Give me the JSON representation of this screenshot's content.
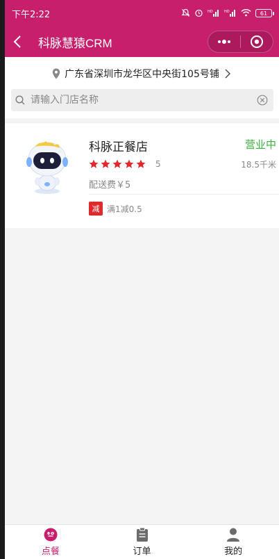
{
  "status_bar": {
    "time": "下午2:22",
    "signal1": "HD",
    "signal2": "HD",
    "battery": "61"
  },
  "nav": {
    "title": "科脉慧猿CRM"
  },
  "location": {
    "address": "广东省深圳市龙华区中央街105号铺"
  },
  "search": {
    "placeholder": "请输入门店名称",
    "value": ""
  },
  "store": {
    "name": "科脉正餐店",
    "status": "营业中",
    "rating": 5,
    "rating_text": "5",
    "distance": "18.5千米",
    "delivery_fee": "配送费￥5",
    "promo_badge": "减",
    "promo_text": "满1减0.5"
  },
  "tabs": [
    {
      "label": "点餐",
      "icon": "order-food-icon",
      "active": true
    },
    {
      "label": "订单",
      "icon": "clipboard-icon",
      "active": false
    },
    {
      "label": "我的",
      "icon": "user-icon",
      "active": false
    }
  ],
  "colors": {
    "brand": "#c81f6d",
    "status_open": "#3db03d",
    "star": "#e0292c",
    "promo": "#e0292c"
  }
}
